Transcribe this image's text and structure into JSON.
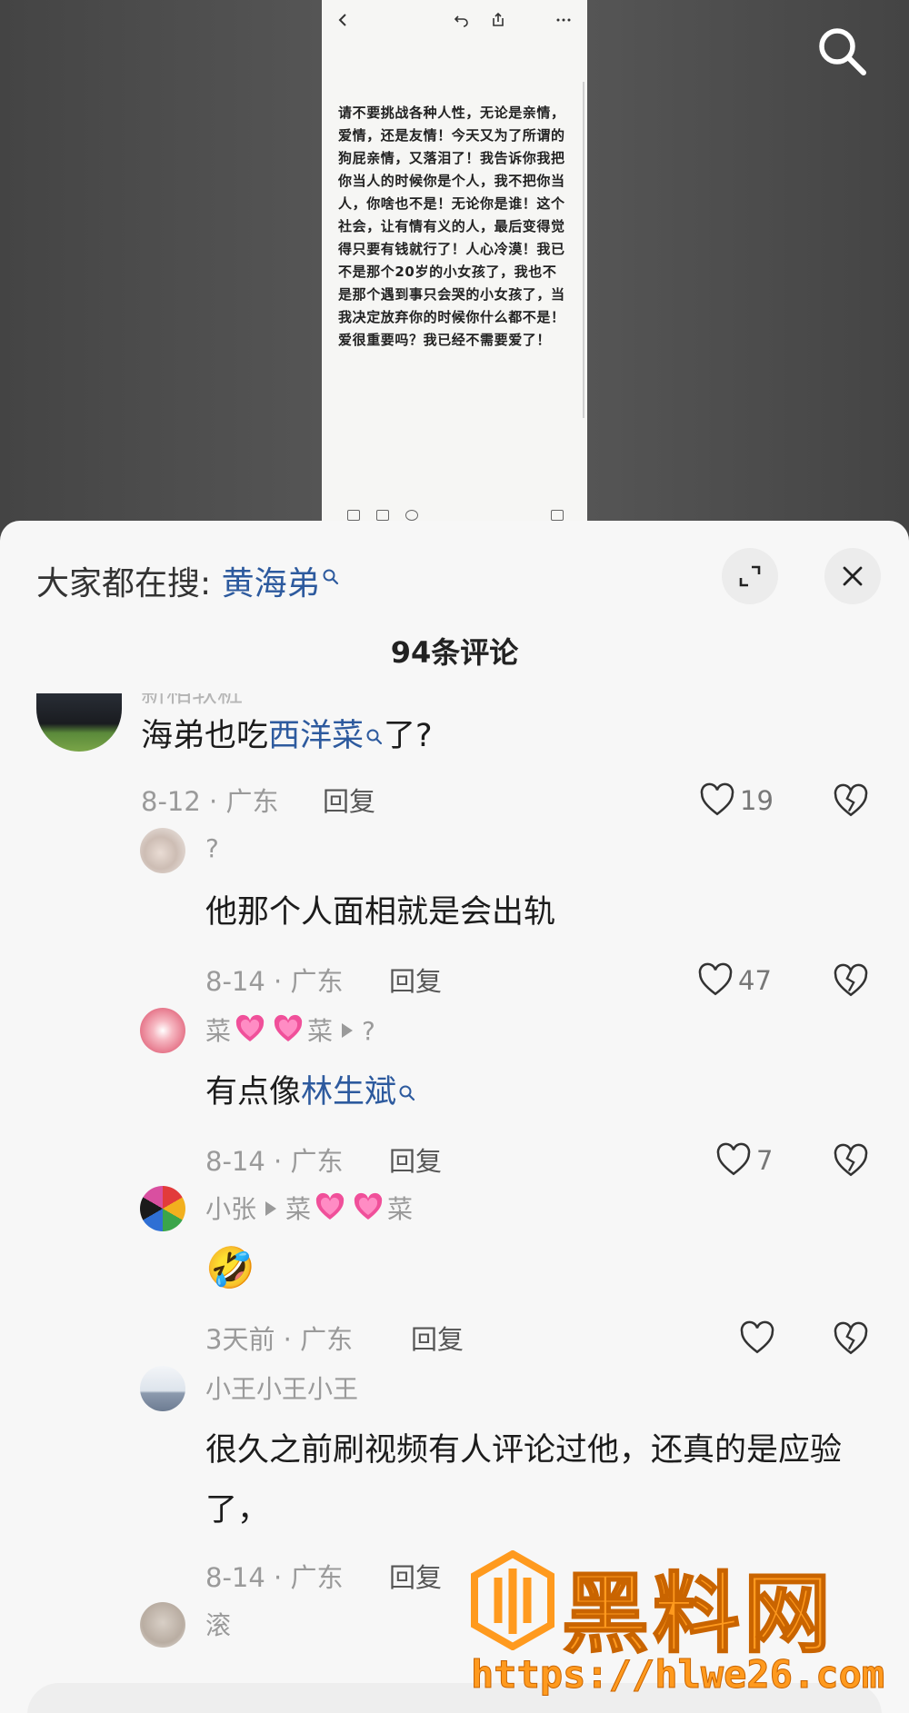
{
  "note": {
    "text": "请不要挑战各种人性，无论是亲情，爱情，还是友情！今天又为了所谓的狗屁亲情，又落泪了！我告诉你我把你当人的时候你是个人，我不把你当人，你啥也不是！无论你是谁！这个社会，让有情有义的人，最后变得觉得只要有钱就行了！人心冷漠！我已不是那个20岁的小女孩了，我也不是那个遇到事只会哭的小女孩了，当我决定放弃你的时候你什么都不是！爱很重要吗？我已经不需要爱了！"
  },
  "sheet": {
    "search_prefix": "大家都在搜:",
    "search_keyword": "黄海弟",
    "count_title": "94条评论",
    "reply_label": "回复"
  },
  "comments": [
    {
      "name": "新相软粧",
      "text_before": "海弟也吃",
      "keyword": "西洋菜",
      "text_after": "了?",
      "meta": "8-12 · 广东",
      "likes": "19"
    },
    {
      "name": "?",
      "text": "他那个人面相就是会出轨",
      "meta": "8-14 · 广东",
      "likes": "47"
    },
    {
      "name_a": "菜",
      "name_b": "菜",
      "reply_to": "?",
      "text_before": "有点像",
      "keyword": "林生斌",
      "meta": "8-14 · 广东",
      "likes": "7"
    },
    {
      "name": "小张",
      "reply_to_a": "菜",
      "reply_to_b": "菜",
      "text": "🤣",
      "meta": "3天前 · 广东",
      "likes": ""
    },
    {
      "name": "小王小王小王",
      "text": "很久之前刷视频有人评论过他，还真的是应验了，",
      "meta": "8-14 · 广东"
    },
    {
      "name": "滚"
    }
  ],
  "watermark": {
    "title": "黑料网",
    "url": "https://hlwe26.com"
  },
  "colors": {
    "keyword": "#2d5a9e",
    "meta": "#9a9a9a",
    "watermark": "#ff9a1e"
  }
}
